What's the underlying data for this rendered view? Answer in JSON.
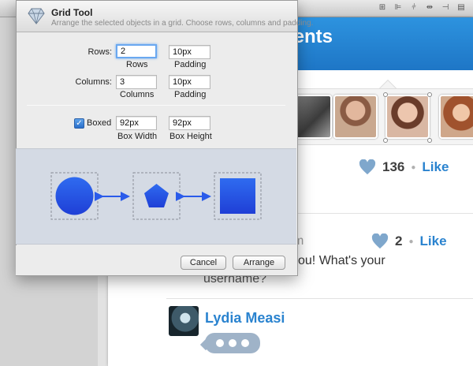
{
  "app": {
    "header_title": "Comments",
    "likes": [
      {
        "count": "136",
        "link": "Like"
      },
      {
        "count": "2",
        "link": "Like"
      }
    ],
    "comment_fragments": [
      "m",
      "ou! What's your",
      "username?"
    ],
    "author_name": "Lydia Measi"
  },
  "panel": {
    "title": "Grid Tool",
    "subtitle": "Arrange the selected objects in a grid. Choose rows, columns and padding.",
    "rows_label": "Rows:",
    "rows_value": "2",
    "rows_sublabel": "Rows",
    "rows_padding_value": "10px",
    "rows_padding_sublabel": "Padding",
    "columns_label": "Columns:",
    "columns_value": "3",
    "columns_sublabel": "Columns",
    "columns_padding_value": "10px",
    "columns_padding_sublabel": "Padding",
    "boxed_label": "Boxed",
    "boxed_checked": true,
    "box_width_value": "92px",
    "box_width_sublabel": "Box Width",
    "box_height_value": "92px",
    "box_height_sublabel": "Box Height",
    "cancel_label": "Cancel",
    "arrange_label": "Arrange"
  },
  "colors": {
    "header_blue": "#2589d8",
    "link_blue": "#2a83cf",
    "shape_blue": "#2a5bea",
    "preview_bg": "#d4dae4"
  },
  "icons": [
    "align-icon",
    "distribute-icon",
    "resize-icon",
    "grid-icon",
    "diamond-logo-icon",
    "heart-icon",
    "check-icon"
  ]
}
